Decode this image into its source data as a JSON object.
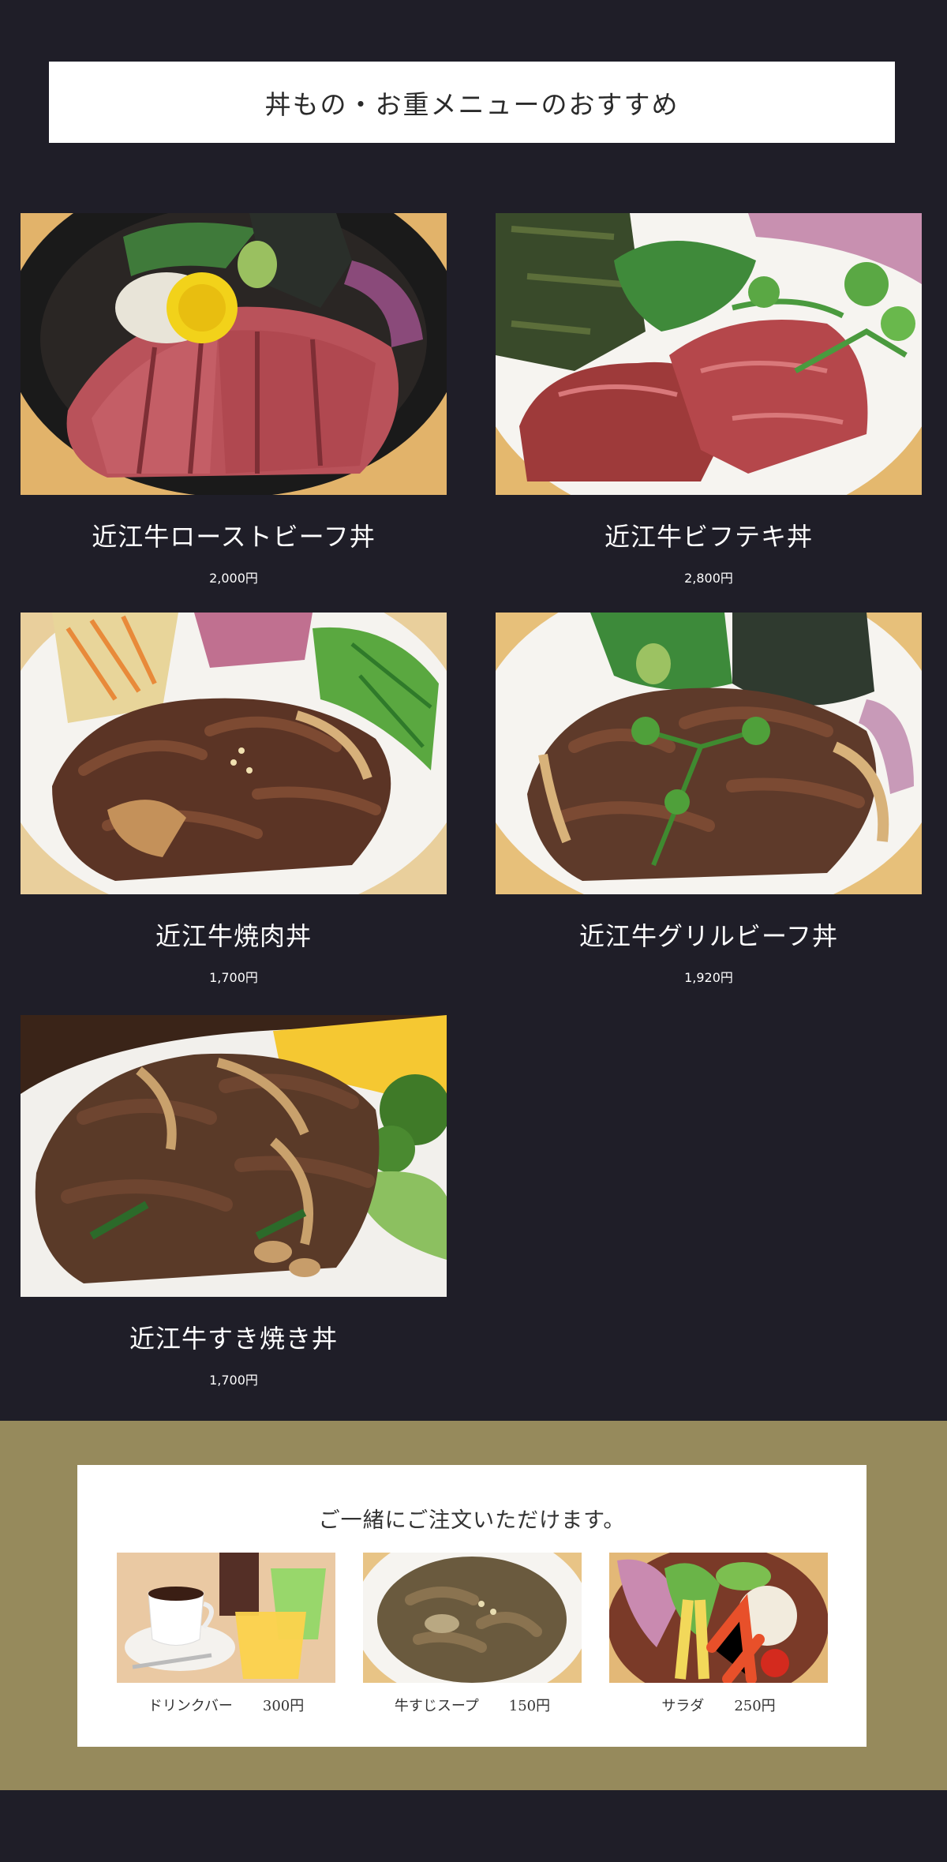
{
  "heading": "丼もの・お重メニューのおすすめ",
  "menu": [
    {
      "name": "近江牛ローストビーフ丼",
      "price": "2,000円",
      "photo": "roast-beef-bowl"
    },
    {
      "name": "近江牛ビフテキ丼",
      "price": "2,800円",
      "photo": "beef-steak-bowl"
    },
    {
      "name": "近江牛焼肉丼",
      "price": "1,700円",
      "photo": "yakiniku-bowl"
    },
    {
      "name": "近江牛グリルビーフ丼",
      "price": "1,920円",
      "photo": "grilled-beef-bowl"
    },
    {
      "name": "近江牛すき焼き丼",
      "price": "1,700円",
      "photo": "sukiyaki-bowl"
    }
  ],
  "sides": {
    "title": "ご一緒にご注文いただけます。",
    "items": [
      {
        "name": "ドリンクバー",
        "price": "300円",
        "photo": "drink-bar"
      },
      {
        "name": "牛すじスープ",
        "price": "150円",
        "photo": "beef-tendon-soup"
      },
      {
        "name": "サラダ",
        "price": "250円",
        "photo": "salad"
      }
    ]
  },
  "colors": {
    "background": "#1f1e28",
    "band": "#968a5c",
    "card": "#ffffff"
  }
}
